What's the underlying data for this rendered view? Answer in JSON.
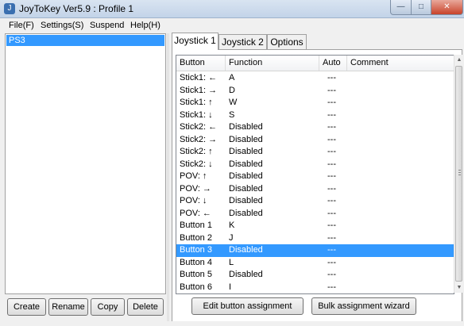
{
  "window": {
    "title": "JoyToKey Ver5.9 : Profile 1",
    "icon_glyph": "J",
    "minimize_glyph": "—",
    "maximize_glyph": "□",
    "close_glyph": "✕"
  },
  "menu": [
    "File(F)",
    "Settings(S)",
    "Suspend",
    "Help(H)"
  ],
  "profiles": {
    "items": [
      "PS3"
    ],
    "selected": 0,
    "buttons": [
      "Create",
      "Rename",
      "Copy",
      "Delete"
    ]
  },
  "tabs": [
    "Joystick 1",
    "Joystick 2",
    "Options"
  ],
  "active_tab": 0,
  "table": {
    "columns": [
      "Button",
      "Function",
      "Auto",
      "Comment"
    ],
    "rows": [
      {
        "button": "Stick1: ←",
        "function": "A",
        "auto": "---",
        "comment": ""
      },
      {
        "button": "Stick1: →",
        "function": "D",
        "auto": "---",
        "comment": ""
      },
      {
        "button": "Stick1: ↑",
        "function": "W",
        "auto": "---",
        "comment": ""
      },
      {
        "button": "Stick1: ↓",
        "function": "S",
        "auto": "---",
        "comment": ""
      },
      {
        "button": "Stick2: ←",
        "function": "Disabled",
        "auto": "---",
        "comment": ""
      },
      {
        "button": "Stick2: →",
        "function": "Disabled",
        "auto": "---",
        "comment": ""
      },
      {
        "button": "Stick2: ↑",
        "function": "Disabled",
        "auto": "---",
        "comment": ""
      },
      {
        "button": "Stick2: ↓",
        "function": "Disabled",
        "auto": "---",
        "comment": ""
      },
      {
        "button": "POV: ↑",
        "function": "Disabled",
        "auto": "---",
        "comment": ""
      },
      {
        "button": "POV: →",
        "function": "Disabled",
        "auto": "---",
        "comment": ""
      },
      {
        "button": "POV: ↓",
        "function": "Disabled",
        "auto": "---",
        "comment": ""
      },
      {
        "button": "POV: ←",
        "function": "Disabled",
        "auto": "---",
        "comment": ""
      },
      {
        "button": "Button 1",
        "function": "K",
        "auto": "---",
        "comment": ""
      },
      {
        "button": "Button 2",
        "function": "J",
        "auto": "---",
        "comment": ""
      },
      {
        "button": "Button 3",
        "function": "Disabled",
        "auto": "---",
        "comment": ""
      },
      {
        "button": "Button 4",
        "function": "L",
        "auto": "---",
        "comment": ""
      },
      {
        "button": "Button 5",
        "function": "Disabled",
        "auto": "---",
        "comment": ""
      },
      {
        "button": "Button 6",
        "function": "I",
        "auto": "---",
        "comment": ""
      }
    ],
    "selected_row": 14
  },
  "actions": {
    "edit": "Edit button assignment",
    "bulk": "Bulk assignment wizard"
  },
  "colors": {
    "selection": "#3399ff",
    "close_button": "#c8432a"
  }
}
